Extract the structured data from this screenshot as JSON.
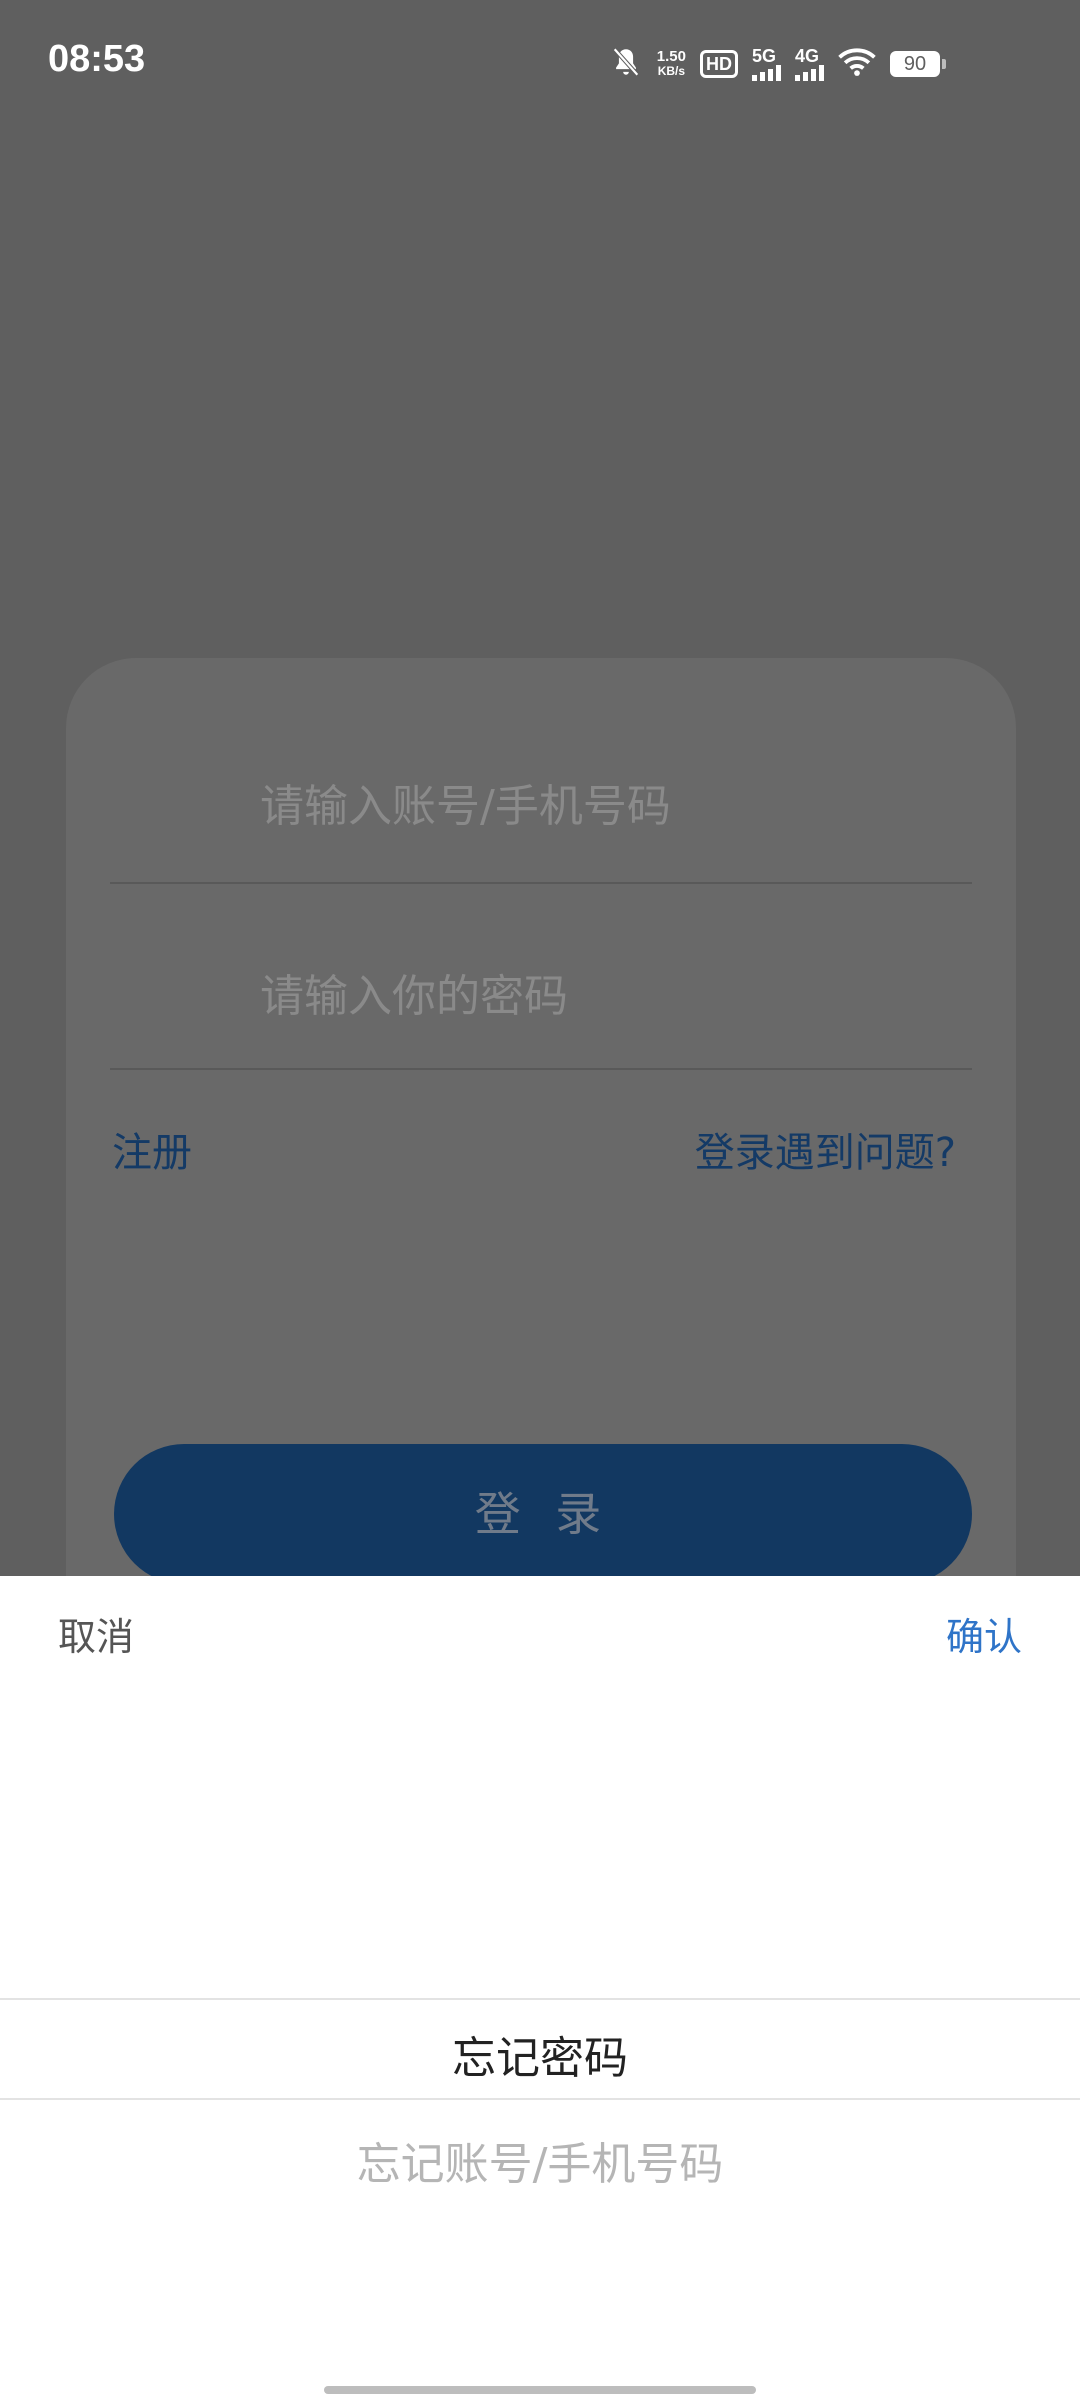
{
  "status_bar": {
    "time": "08:53",
    "net_speed_value": "1.50",
    "net_speed_unit": "KB/s",
    "hd_label": "HD",
    "sim1_network": "5G",
    "sim2_network": "4G",
    "battery": "90"
  },
  "login": {
    "account_placeholder": "请输入账号/手机号码",
    "password_placeholder": "请输入你的密码",
    "register_link": "注册",
    "trouble_link": "登录遇到问题?",
    "login_button": "登 录"
  },
  "sheet": {
    "cancel": "取消",
    "confirm": "确认",
    "options": [
      {
        "label": "忘记密码",
        "selected": true
      },
      {
        "label": "忘记账号/手机号码",
        "selected": false
      }
    ]
  },
  "colors": {
    "confirm_blue": "#2f74c8",
    "login_button": "#123861",
    "link_blue": "#143a66"
  }
}
